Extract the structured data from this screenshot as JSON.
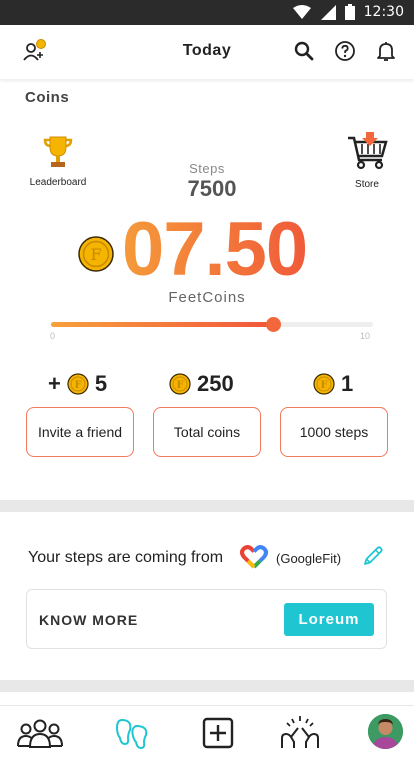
{
  "status_bar": {
    "time": "12:30"
  },
  "header": {
    "title": "Today"
  },
  "coins_section": {
    "title": "Coins",
    "leaderboard_label": "Leaderboard",
    "store_label": "Store",
    "steps_label": "Steps",
    "steps_value": "7500",
    "coins_value": "07.50",
    "currency_label": "FeetCoins",
    "slider": {
      "min": "0",
      "max": "10",
      "value_fraction": 0.69
    },
    "stats": [
      {
        "prefix": "+",
        "value": "5",
        "button": "Invite a friend"
      },
      {
        "prefix": "",
        "value": "250",
        "button": "Total coins"
      },
      {
        "prefix": "",
        "value": "1",
        "button": "1000 steps"
      }
    ]
  },
  "source_section": {
    "text": "Your steps are coming from",
    "provider": "(GoogleFit)",
    "card_label": "KNOW MORE",
    "card_button": "Loreum"
  },
  "colors": {
    "accent_orange": "#f2683c",
    "accent_teal": "#1fc6d2",
    "coin_gold": "#f5b400"
  }
}
